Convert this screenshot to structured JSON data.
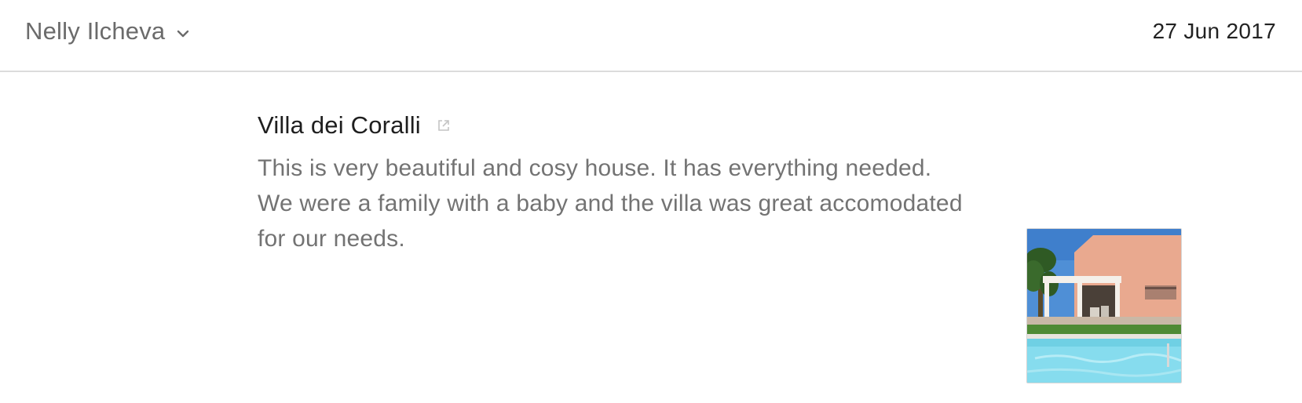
{
  "header": {
    "author_name": "Nelly Ilcheva",
    "author_dropdown_icon": "chevron-down-icon",
    "date": "27 Jun 2017"
  },
  "review": {
    "title": "Villa dei Coralli",
    "title_link_icon": "external-link-icon",
    "text": "This is very beautiful and cosy house. It has everything needed. We were a family with a baby and the villa was great accomodated for our needs."
  },
  "photo": {
    "subject": "villa-with-pool-thumbnail"
  },
  "colors": {
    "divider": "#dcdcdc",
    "author_text": "#6b6b6b",
    "title_text": "#1e1e1e",
    "body_text": "#737373"
  }
}
